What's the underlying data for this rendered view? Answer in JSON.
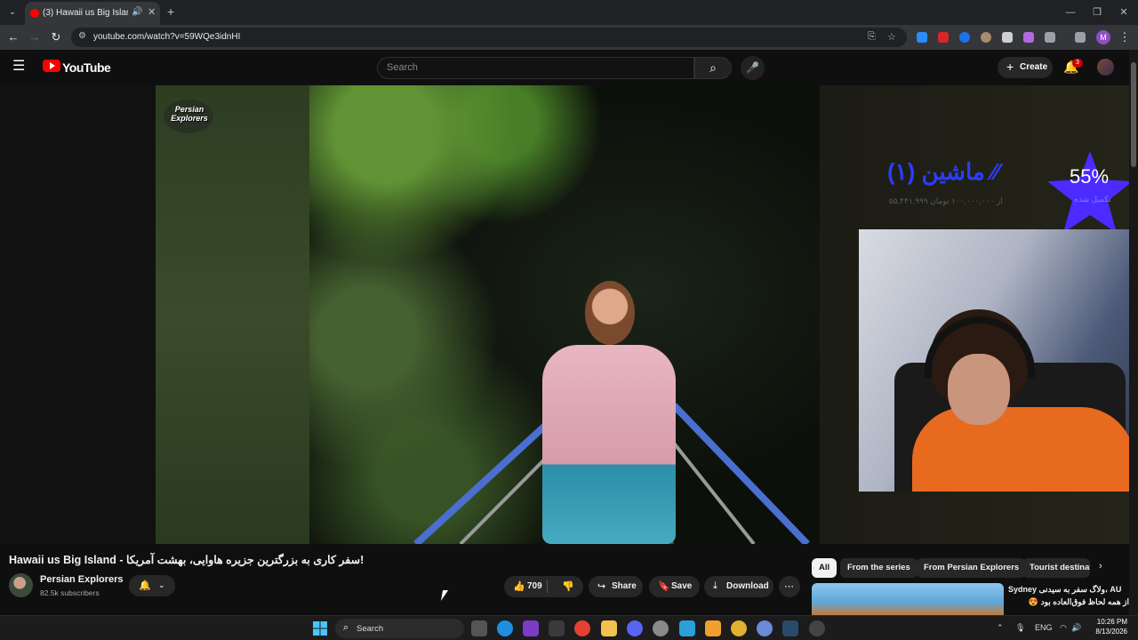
{
  "browser": {
    "tab_title": "(3) Hawaii us Big Island - (س",
    "new_tab": "+",
    "url": "youtube.com/watch?v=59WQe3idnHI",
    "profile_initial": "M"
  },
  "youtube": {
    "logo_text": "YouTube",
    "search_placeholder": "Search",
    "create_label": "Create",
    "notification_count": "3"
  },
  "player": {
    "watermark": "Persian Explorers",
    "overlay": {
      "goal_title": "ماشین (۱) ∕∕",
      "goal_sub": "۵۵,۴۴۱,۹۹۹ از ۱۰۰,۰۰۰,۰۰۰ تومان",
      "goal_percent": "55%",
      "goal_status": "تکمیل شده"
    }
  },
  "video": {
    "title": "Hawaii us Big Island - سفر کاری به بزرگترین جزیره هاوایی، بهشت آمریکا!",
    "channel_name": "Persian Explorers",
    "subscribers": "82.5k subscribers",
    "likes": "709",
    "share_label": "Share",
    "save_label": "Save",
    "download_label": "Download"
  },
  "chips": [
    "All",
    "From the series",
    "From Persian Explorers",
    "Tourist destinat"
  ],
  "recommendation": {
    "title_line1": "Sydney ولاگ سفر به سیدنی، AU",
    "title_line2": "از همه لحاظ فوق‌العاده بود 😍"
  },
  "taskbar": {
    "search_label": "Search",
    "language": "ENG",
    "time": "10:26 PM",
    "date": "8/13/2026"
  },
  "colors": {
    "youtube_red": "#ff0000",
    "goal_blue": "#2b3cff",
    "star_purple": "#4b2bff",
    "shirt_orange": "#e86a1e"
  }
}
